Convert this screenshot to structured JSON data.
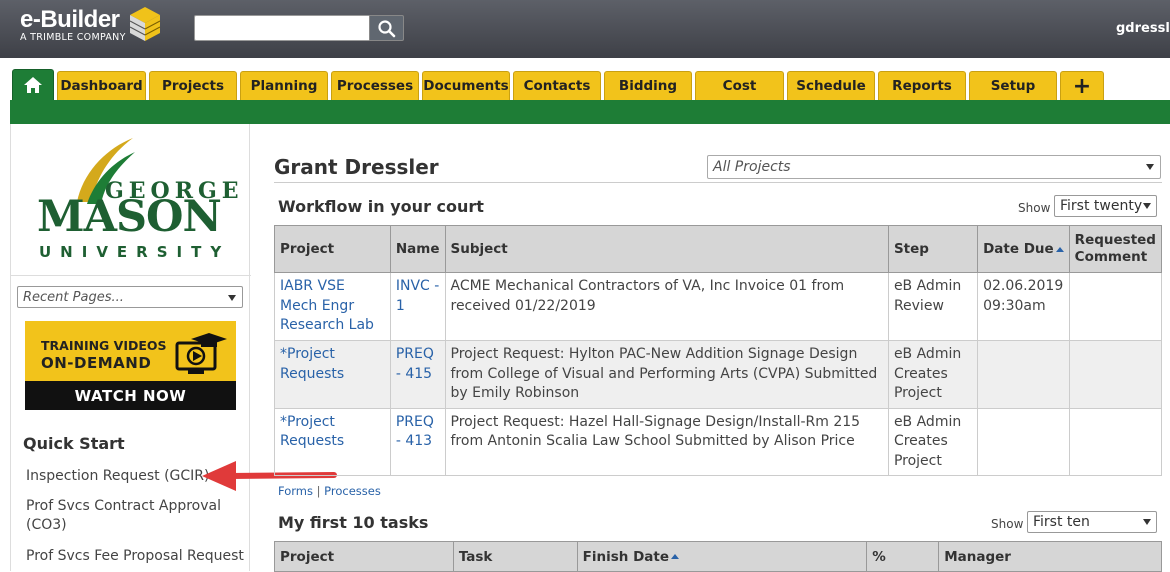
{
  "app": {
    "brand": "e-Builder",
    "tagline": "A TRIMBLE COMPANY",
    "user": "gdressl@"
  },
  "search": {
    "placeholder": "",
    "value": ""
  },
  "tabs": [
    "Dashboard",
    "Projects",
    "Planning",
    "Processes",
    "Documents",
    "Contacts",
    "Bidding",
    "Cost",
    "Schedule",
    "Reports",
    "Setup"
  ],
  "tab_plus": "+",
  "sidebar": {
    "org": {
      "line1": "GEORGE",
      "line2": "MASON",
      "line3": "UNIVERSITY"
    },
    "recent_placeholder": "Recent Pages...",
    "promo": {
      "line1": "TRAINING VIDEOS",
      "line2": "ON-DEMAND",
      "button": "WATCH NOW"
    },
    "quick_start_title": "Quick Start",
    "quick_start": [
      "Inspection Request (GCIR)",
      "Prof Svcs Contract Approval (CO3)",
      "Prof Svcs Fee Proposal Request"
    ]
  },
  "main": {
    "title": "Grant Dressler",
    "project_filter": "All Projects",
    "workflow": {
      "title": "Workflow in your court",
      "show_label": "Show",
      "show_value": "First twenty",
      "columns": [
        "Project",
        "Name",
        "Subject",
        "Step",
        "Date Due",
        "Requested Comment"
      ],
      "rows": [
        {
          "project": "IABR VSE Mech Engr Research Lab",
          "name": "INVC - 1",
          "subject": "ACME Mechanical Contractors of VA, Inc Invoice 01 from received 01/22/2019",
          "step": "eB Admin Review",
          "date_due": "02.06.2019 09:30am",
          "comment": ""
        },
        {
          "project": "*Project Requests",
          "name": "PREQ - 415",
          "subject": "Project Request: Hylton PAC-New Addition Signage Design from College of Visual and Performing Arts (CVPA) Submitted by Emily Robinson",
          "step": "eB Admin Creates Project",
          "date_due": "",
          "comment": ""
        },
        {
          "project": "*Project Requests",
          "name": "PREQ - 413",
          "subject": "Project Request: Hazel Hall-Signage Design/Install-Rm 215 from Antonin Scalia Law School Submitted by Alison Price",
          "step": "eB Admin Creates Project",
          "date_due": "",
          "comment": ""
        }
      ],
      "links": [
        "Forms",
        "Processes"
      ],
      "link_sep": "|"
    },
    "tasks": {
      "title": "My first 10 tasks",
      "show_label": "Show",
      "show_value": "First ten",
      "columns": [
        "Project",
        "Task",
        "Finish Date",
        "%",
        "Manager"
      ]
    }
  },
  "colors": {
    "green": "#1e7d36",
    "gold": "#f2c31b",
    "topbar": "#4a4d54",
    "arrow": "#e03a3a"
  }
}
